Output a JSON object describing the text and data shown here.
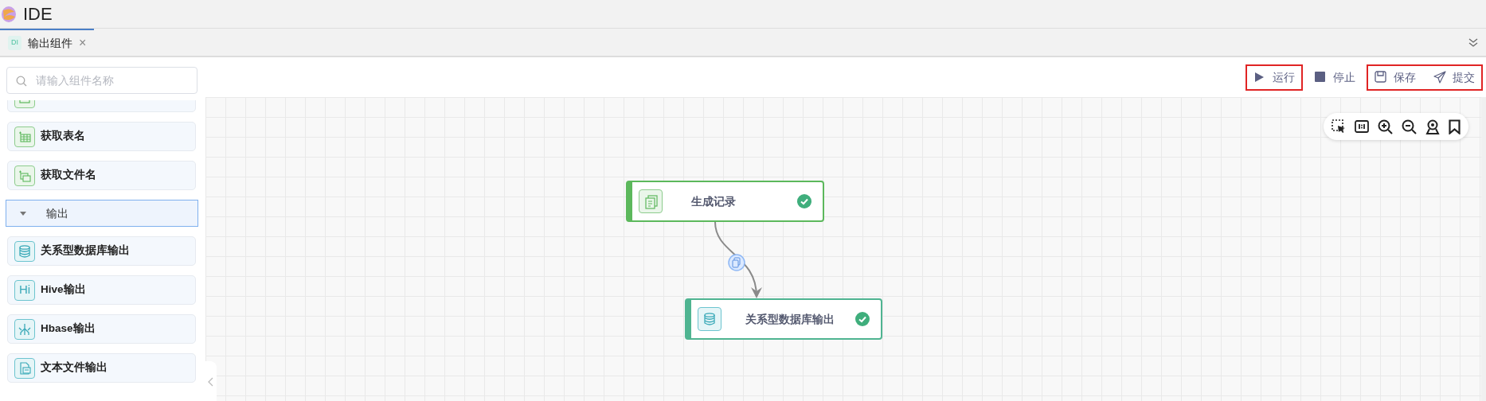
{
  "app": {
    "title": "IDE"
  },
  "tabs": [
    {
      "badge": "DI",
      "label": "输出组件",
      "close": "×",
      "selected": true
    }
  ],
  "sidebar": {
    "search": {
      "placeholder": "请输入组件名称"
    },
    "items": [
      {
        "kind": "component"
      },
      {
        "kind": "component",
        "label": "获取表名"
      },
      {
        "kind": "component",
        "label": "获取文件名"
      },
      {
        "kind": "category",
        "label": "输出",
        "expanded": true
      },
      {
        "kind": "component",
        "label": "关系型数据库输出"
      },
      {
        "kind": "component",
        "icon_text": "Hi",
        "label": "Hive输出"
      },
      {
        "kind": "component",
        "label": "Hbase输出"
      },
      {
        "kind": "component",
        "label": "文本文件输出"
      }
    ]
  },
  "toolbar": [
    {
      "highlighted": true,
      "buttons": [
        {
          "label": "运行"
        }
      ]
    },
    {
      "highlighted": false,
      "buttons": [
        {
          "label": "停止"
        }
      ]
    },
    {
      "highlighted": true,
      "buttons": [
        {
          "label": "保存"
        },
        {
          "label": "提交"
        }
      ]
    }
  ],
  "canvas": {
    "nodes": [
      {
        "label": "生成记录",
        "color": "#5cb85c",
        "complete": true
      },
      {
        "label": "关系型数据库输出",
        "color": "#4fb491",
        "complete": true
      }
    ]
  }
}
